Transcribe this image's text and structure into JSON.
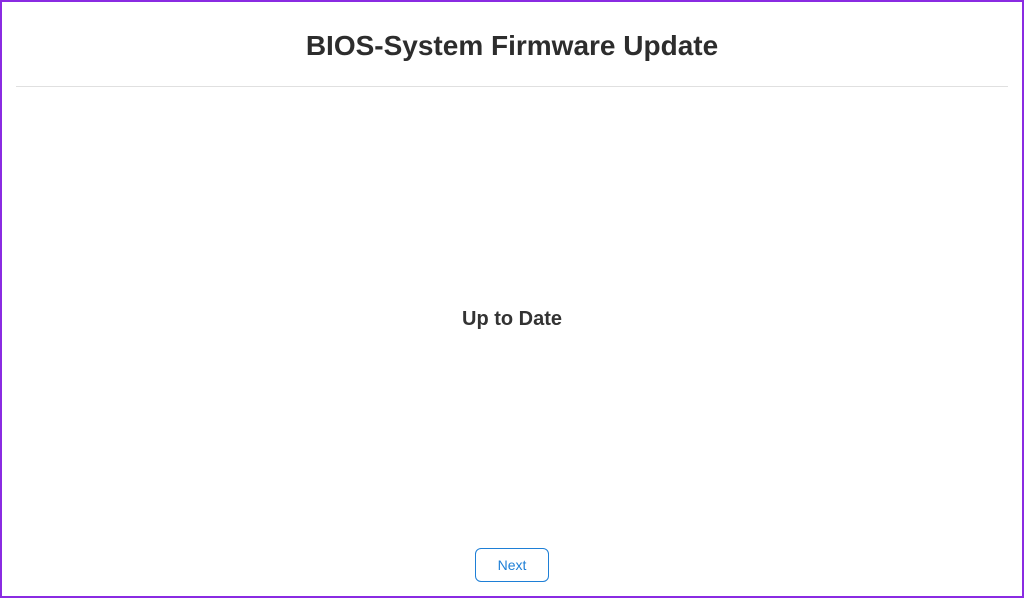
{
  "header": {
    "title": "BIOS-System Firmware Update"
  },
  "content": {
    "status_message": "Up to Date"
  },
  "footer": {
    "next_button_label": "Next"
  }
}
